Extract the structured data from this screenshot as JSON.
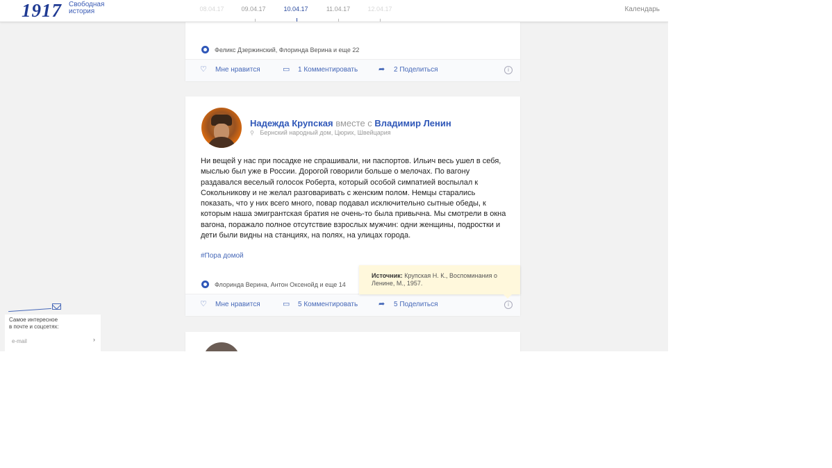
{
  "header": {
    "logo_number": "1917",
    "logo_line1": "Свободная",
    "logo_line2": "история",
    "dates": [
      "08.04.17",
      "09.04.17",
      "10.04.17",
      "11.04.17",
      "12.04.17"
    ],
    "active_date": "10.04.17",
    "calendar_label": "Календарь"
  },
  "post1": {
    "participants": "Феликс Дзержинский, Флоринда Верина и еще 22",
    "like_label": "Мне нравится",
    "comment_label": "1 Комментировать",
    "share_label": "2 Поделиться",
    "info_icon": "i"
  },
  "post2": {
    "author": "Надежда Крупская",
    "with_word": "вместе с",
    "coauthor": "Владимир Ленин",
    "location": "Бернский народный дом, Цюрих, Швейцария",
    "text": "Ни вещей у нас при посадке не спрашивали, ни паспортов. Ильич весь ушел в себя, мыслью был уже в России. Дорогой говорили больше о мелочах. По вагону раздавался веселый голосок Роберта, который особой симпатией воспылал к Сокольникову и не желал разговаривать с женским полом. Немцы старались показать, что у них всего много, повар подавал исключительно сытные обеды, к которым наша эмигрантская братия не очень-то была привычна. Мы смотрели в окна вагона, поражало полное отсутствие взрослых мужчин: одни женщины, подростки и дети были видны на станциях, на полях, на улицах города.",
    "hashtag": "#Пора домой",
    "participants": "Флоринда Верина, Антон Оксенойд и еще 14",
    "like_label": "Мне нравится",
    "comment_label": "5 Комментировать",
    "share_label": "5 Поделиться",
    "info_icon": "i",
    "tooltip_label": "Источник:",
    "tooltip_text": "Крупская Н. К., Воспоминания о Ленине, М., 1957."
  },
  "subscribe": {
    "line1": "Самое интересное",
    "line2": "в почте и соцсетях:",
    "placeholder": "e-mail",
    "go": "›"
  },
  "icons": {
    "like": "heart-icon",
    "comment": "speech-bubble-icon",
    "share": "share-arrow-icon",
    "info": "info-icon",
    "pin": "location-pin-icon",
    "badge": "participants-badge-icon",
    "envelope": "envelope-icon"
  },
  "colors": {
    "accent": "#2f57b8",
    "link": "#4668b8",
    "tooltip_bg": "#fff8dc",
    "page_bg": "#f2f2f2"
  }
}
